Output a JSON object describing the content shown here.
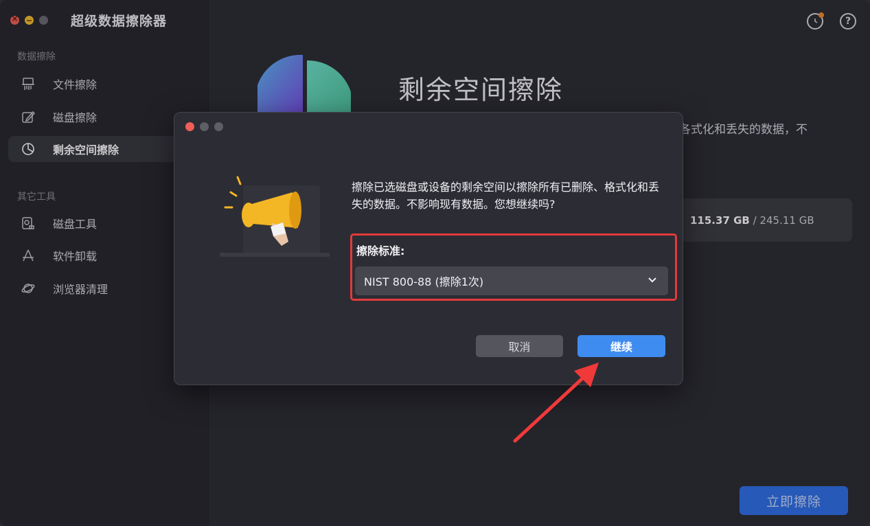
{
  "app": {
    "title": "超级数据擦除器"
  },
  "sidebar": {
    "sections": [
      {
        "title": "数据擦除"
      },
      {
        "title": "其它工具"
      }
    ],
    "items": [
      {
        "label": "文件擦除",
        "icon": "file-shredder-icon"
      },
      {
        "label": "磁盘擦除",
        "icon": "disk-erase-icon"
      },
      {
        "label": "剩余空间擦除",
        "icon": "pie-chart-icon",
        "active": true
      },
      {
        "label": "磁盘工具",
        "icon": "disk-tool-icon"
      },
      {
        "label": "软件卸载",
        "icon": "app-uninstall-icon"
      },
      {
        "label": "浏览器清理",
        "icon": "planet-icon"
      }
    ]
  },
  "header": {
    "icons": [
      "history-icon",
      "help-icon"
    ]
  },
  "main": {
    "title": "剩余空间擦除",
    "description_fragment": "各式化和丢失的数据，不",
    "disk": {
      "used": "115.37 GB",
      "separator": " / ",
      "total": "245.11 GB"
    },
    "erase_button": "立即擦除"
  },
  "dialog": {
    "message": "擦除已选磁盘或设备的剩余空间以擦除所有已删除、格式化和丢失的数据。不影响现有数据。您想继续吗?",
    "standard_label": "擦除标准:",
    "standard_value": "NIST 800-88 (擦除1次)",
    "cancel_label": "取消",
    "continue_label": "继续"
  },
  "colors": {
    "accent": "#3f8cf0",
    "highlight_border": "#e43a3a",
    "arrow": "#f03a3a"
  }
}
